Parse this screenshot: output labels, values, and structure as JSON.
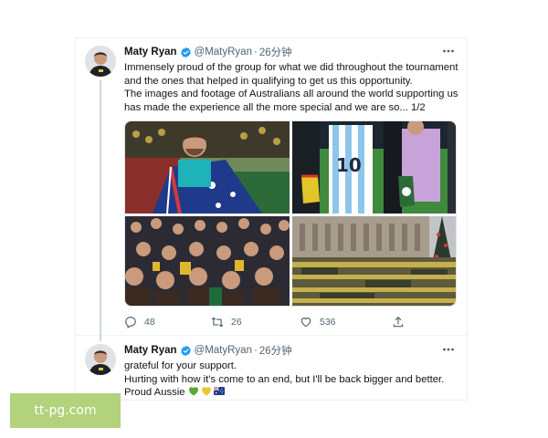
{
  "tweets": [
    {
      "author_name": "Maty Ryan",
      "handle": "@MatyRyan",
      "separator": "·",
      "time": "26分钟",
      "more_icon": "more-horizontal-icon",
      "lines": [
        "Immensely proud of the group for what we did throughout the tournament",
        "and the ones that helped in qualifying to get us this opportunity.",
        "The images and footage of Australians all around the world supporting us",
        "has made the experience all the more special and we are so... 1/2"
      ],
      "media_count": 4,
      "actions": {
        "reply_count": "48",
        "retweet_count": "26",
        "like_count": "536"
      }
    },
    {
      "author_name": "Maty Ryan",
      "handle": "@MatyRyan",
      "separator": "·",
      "time": "26分钟",
      "more_icon": "more-horizontal-icon",
      "lines": [
        "grateful for your support.",
        "Hurting with how it's come to an end, but I'll be back bigger and better.",
        "Proud Aussie"
      ],
      "emojis": [
        "green-heart-emoji",
        "yellow-heart-emoji",
        "australia-flag-emoji"
      ]
    }
  ],
  "watermark": {
    "text": "tt-pg.com"
  },
  "colors": {
    "verified": "#1d9bf0",
    "secondary_text": "#536471",
    "thread_line": "#cfd9de",
    "watermark_bg": "#b2d27b"
  }
}
